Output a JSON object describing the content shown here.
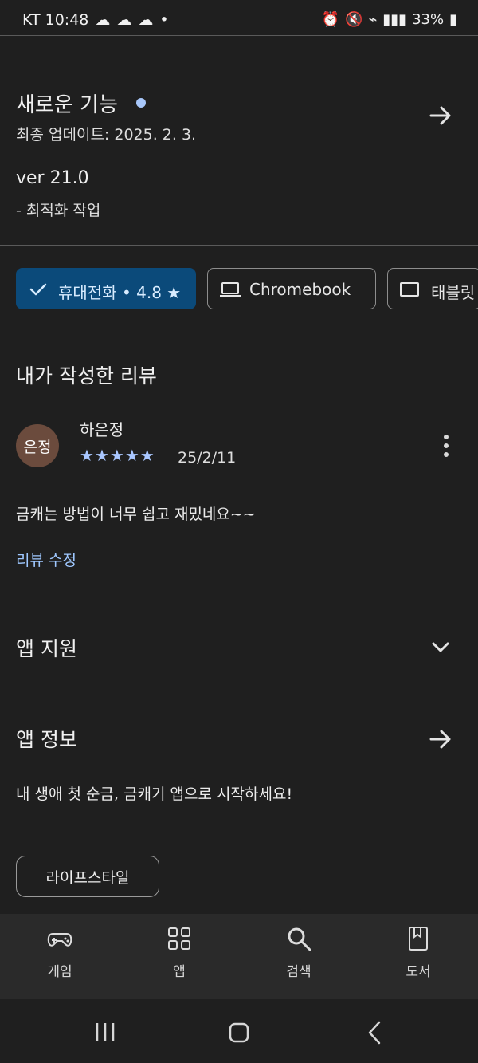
{
  "status_bar": {
    "carrier_time": "KT 10:48",
    "battery": "33%"
  },
  "updates": {
    "title": "새로운 기능",
    "last_updated": "최종 업데이트: 2025. 2. 3.",
    "version": "ver 21.0",
    "note": "- 최적화 작업"
  },
  "device_tabs": [
    {
      "label": "휴대전화 • 4.8 ★",
      "selected": true
    },
    {
      "label": "Chromebook",
      "selected": false
    },
    {
      "label": "태블릿",
      "selected": false
    }
  ],
  "review_section": {
    "title": "내가 작성한 리뷰",
    "avatar_text": "은정",
    "author": "하은정",
    "rating": 5,
    "date": "25/2/11",
    "body": "금캐는 방법이 너무 쉽고 재밌네요~~",
    "edit_link": "리뷰 수정"
  },
  "app_support": {
    "title": "앱 지원"
  },
  "app_info": {
    "title": "앱 정보",
    "description": "내 생애 첫 순금, 금캐기 앱으로 시작하세요!",
    "category": "라이프스타일"
  },
  "bottom_nav": [
    {
      "label": "게임",
      "icon": "gamepad-icon"
    },
    {
      "label": "앱",
      "icon": "apps-grid-icon"
    },
    {
      "label": "검색",
      "icon": "search-icon"
    },
    {
      "label": "도서",
      "icon": "book-icon"
    }
  ],
  "colors": {
    "background": "#1f1f1f",
    "selected_chip": "#0b4a7a",
    "accent_blue": "#9fc8ff",
    "star_blue": "#a9c7ff"
  }
}
